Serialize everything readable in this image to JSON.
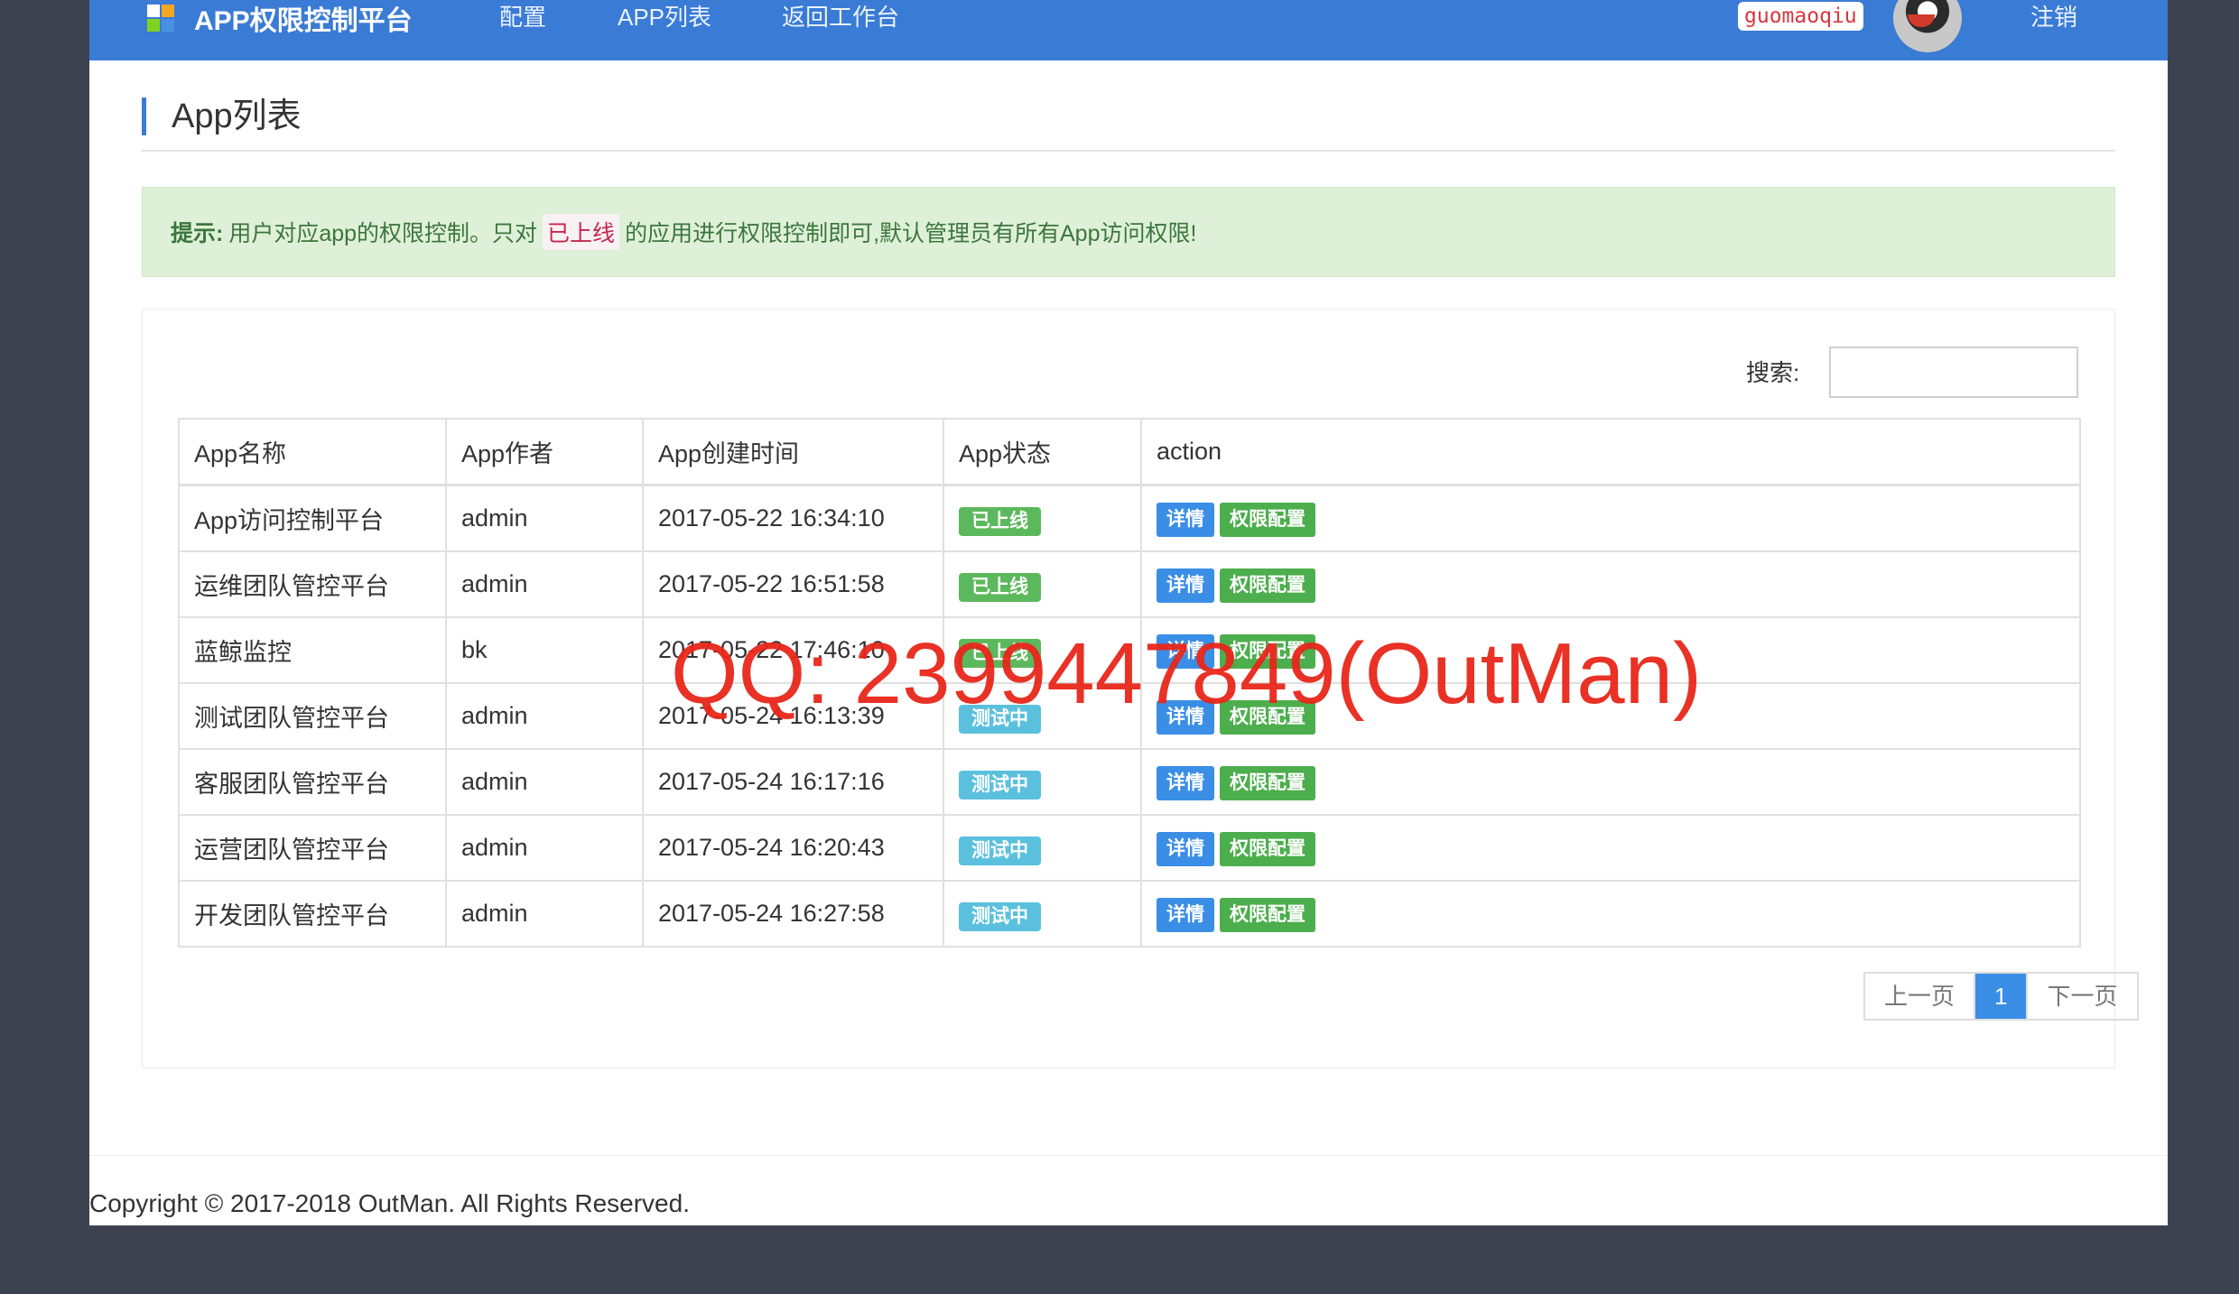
{
  "nav": {
    "brand": "APP权限控制平台",
    "links": [
      "配置",
      "APP列表",
      "返回工作台"
    ],
    "username": "guomaoqiu",
    "logout": "注销"
  },
  "page": {
    "title": "App列表"
  },
  "alert": {
    "label": "提示:",
    "text_before": "用户对应app的权限控制。只对",
    "highlight": "已上线",
    "text_after": "的应用进行权限控制即可,默认管理员有所有App访问权限!"
  },
  "search": {
    "label": "搜索:",
    "value": ""
  },
  "table": {
    "columns": [
      "App名称",
      "App作者",
      "App创建时间",
      "App状态",
      "action"
    ],
    "rows": [
      {
        "name": "App访问控制平台",
        "author": "admin",
        "created": "2017-05-22 16:34:10",
        "status": "已上线",
        "status_color": "#5cb85c"
      },
      {
        "name": "运维团队管控平台",
        "author": "admin",
        "created": "2017-05-22 16:51:58",
        "status": "已上线",
        "status_color": "#5cb85c"
      },
      {
        "name": "蓝鲸监控",
        "author": "bk",
        "created": "2017-05-22 17:46:10",
        "status": "已上线",
        "status_color": "#5cb85c"
      },
      {
        "name": "测试团队管控平台",
        "author": "admin",
        "created": "2017-05-24 16:13:39",
        "status": "测试中",
        "status_color": "#5bc0de"
      },
      {
        "name": "客服团队管控平台",
        "author": "admin",
        "created": "2017-05-24 16:17:16",
        "status": "测试中",
        "status_color": "#5bc0de"
      },
      {
        "name": "运营团队管控平台",
        "author": "admin",
        "created": "2017-05-24 16:20:43",
        "status": "测试中",
        "status_color": "#5bc0de"
      },
      {
        "name": "开发团队管控平台",
        "author": "admin",
        "created": "2017-05-24 16:27:58",
        "status": "测试中",
        "status_color": "#5bc0de"
      }
    ],
    "detail_label": "详情",
    "perm_label": "权限配置"
  },
  "pagination": {
    "prev": "上一页",
    "current": "1",
    "next": "下一页"
  },
  "footer": {
    "copyright": "Copyright © 2017-2018 OutMan. All Rights Reserved."
  },
  "watermark": "QQ: 2399447849(OutMan)",
  "colors": {
    "primary": "#3a7bd5",
    "success": "#5cb85c",
    "info": "#5bc0de",
    "alert_bg": "#dff0d8"
  }
}
